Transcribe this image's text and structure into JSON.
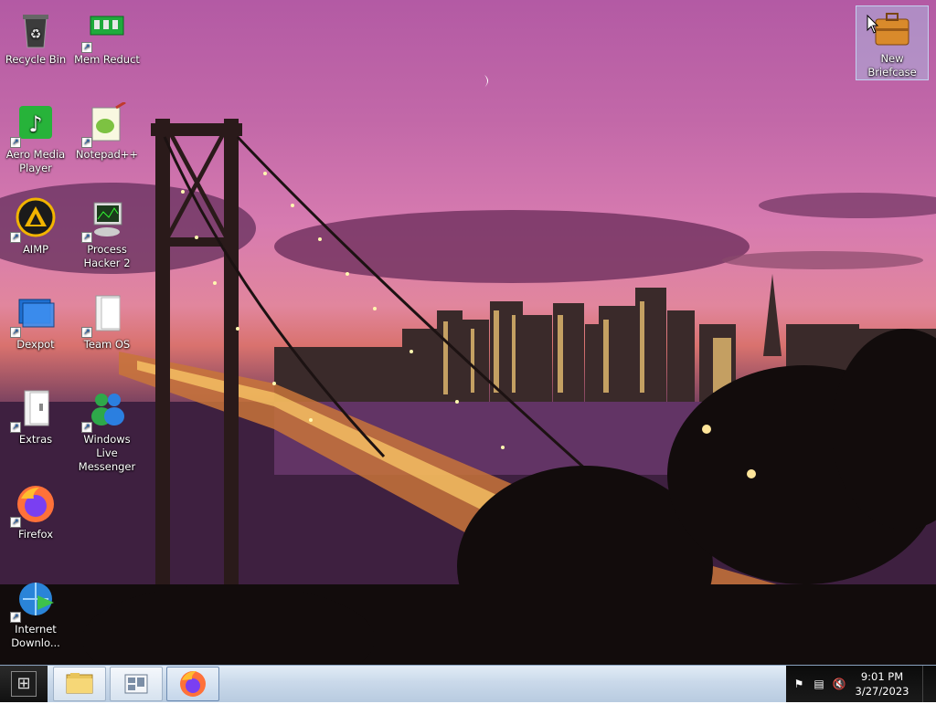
{
  "desktop": {
    "icons": [
      {
        "label": "Recycle Bin",
        "icon": "recycle-bin-icon"
      },
      {
        "label": "Mem Reduct",
        "icon": "memory-chip-icon"
      },
      {
        "label": "Aero Media Player",
        "icon": "music-note-icon"
      },
      {
        "label": "Notepad++",
        "icon": "notepad-chameleon-icon"
      },
      {
        "label": "AIMP",
        "icon": "aimp-triangle-icon"
      },
      {
        "label": "Process Hacker 2",
        "icon": "process-monitor-icon"
      },
      {
        "label": "Dexpot",
        "icon": "virtual-desktops-icon"
      },
      {
        "label": "Team OS",
        "icon": "folder-open-icon"
      },
      {
        "label": "Extras",
        "icon": "folder-open-icon"
      },
      {
        "label": "Windows Live Messenger",
        "icon": "messenger-buddies-icon"
      },
      {
        "label": "Firefox",
        "icon": "firefox-icon"
      },
      {
        "label": "Internet Downlo...",
        "icon": "download-globe-icon"
      },
      {
        "label": "New Briefcase",
        "icon": "briefcase-icon"
      }
    ],
    "shortcut_glyph": "↗"
  },
  "taskbar": {
    "clock_time": "9:01 PM",
    "clock_date": "3/27/2023",
    "pinned": [
      {
        "name": "explorer",
        "icon": "file-explorer-icon"
      },
      {
        "name": "dexpot",
        "icon": "virtual-desktops-icon"
      },
      {
        "name": "firefox",
        "icon": "firefox-icon"
      }
    ],
    "tray": [
      "action-center-flag-icon",
      "network-icon",
      "volume-muted-icon"
    ],
    "start_glyph": "⊞"
  },
  "colors": {
    "taskbar_light": "#e2ecf6",
    "tray_dark": "#111111",
    "firefox_orange": "#ff7139"
  }
}
